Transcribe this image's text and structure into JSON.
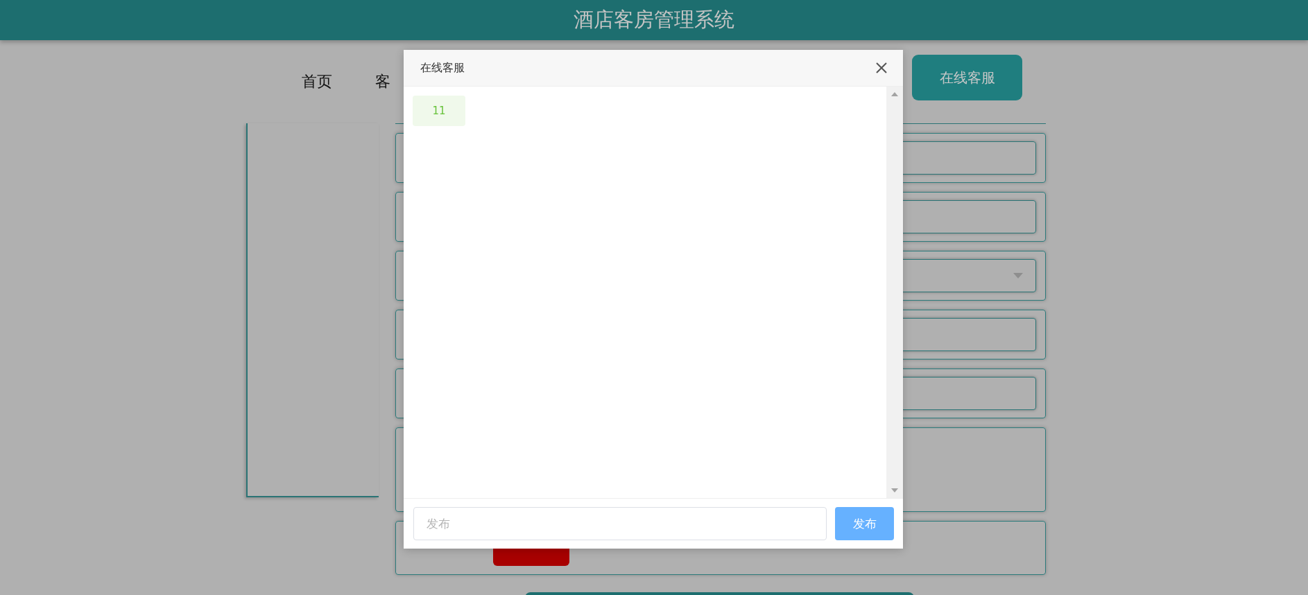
{
  "header": {
    "title": "酒店客房管理系统"
  },
  "nav": {
    "items": [
      {
        "label": "首页"
      },
      {
        "label": "客"
      }
    ],
    "service_button": "在线客服"
  },
  "form": {
    "rows": [
      {
        "kind": "input"
      },
      {
        "kind": "input"
      },
      {
        "kind": "select"
      },
      {
        "kind": "input"
      },
      {
        "kind": "input"
      },
      {
        "kind": "textarea"
      },
      {
        "kind": "upload"
      }
    ]
  },
  "dialog": {
    "title": "在线客服",
    "messages": [
      {
        "text": "11"
      }
    ],
    "input": {
      "placeholder": "发布"
    },
    "send_button": "发布"
  }
}
